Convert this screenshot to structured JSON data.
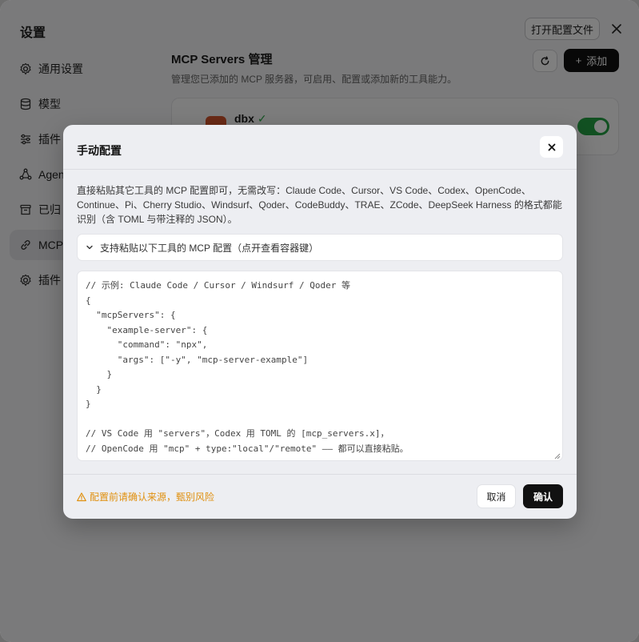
{
  "settings": {
    "title": "设置",
    "open_config_label": "打开配置文件"
  },
  "sidebar": {
    "items": [
      {
        "label": "通用设置",
        "icon": "gear-icon"
      },
      {
        "label": "模型",
        "icon": "database-icon"
      },
      {
        "label": "插件",
        "icon": "sliders-icon"
      },
      {
        "label": "Agen",
        "icon": "network-icon"
      },
      {
        "label": "已归",
        "icon": "archive-icon"
      },
      {
        "label": "MCP",
        "icon": "link-icon"
      },
      {
        "label": "插件",
        "icon": "gear-icon"
      }
    ]
  },
  "mcp": {
    "heading": "MCP Servers 管理",
    "subtitle": "管理您已添加的 MCP 服务器，可启用、配置或添加新的工具能力。",
    "add_label": "添加",
    "server": {
      "name": "dbx",
      "status": "✓",
      "enabled": true
    }
  },
  "modal": {
    "title": "手动配置",
    "description": "直接粘贴其它工具的 MCP 配置即可，无需改写：Claude Code、Cursor、VS Code、Codex、OpenCode、Continue、Pi、Cherry Studio、Windsurf、Qoder、CodeBuddy、TRAE、ZCode、DeepSeek Harness 的格式都能识别（含 TOML 与带注释的 JSON）。",
    "collapse_label": "支持粘贴以下工具的 MCP 配置（点开查看容器键）",
    "code": "// 示例: Claude Code / Cursor / Windsurf / Qoder 等\n{\n  \"mcpServers\": {\n    \"example-server\": {\n      \"command\": \"npx\",\n      \"args\": [\"-y\", \"mcp-server-example\"]\n    }\n  }\n}\n\n// VS Code 用 \"servers\"，Codex 用 TOML 的 [mcp_servers.x]，\n// OpenCode 用 \"mcp\" + type:\"local\"/\"remote\" —— 都可以直接粘贴。",
    "warning": "配置前请确认来源，甄别风险",
    "cancel_label": "取消",
    "confirm_label": "确认"
  },
  "colors": {
    "accent": "#111111",
    "toggle_on": "#25a244",
    "warning": "#e0900f"
  }
}
